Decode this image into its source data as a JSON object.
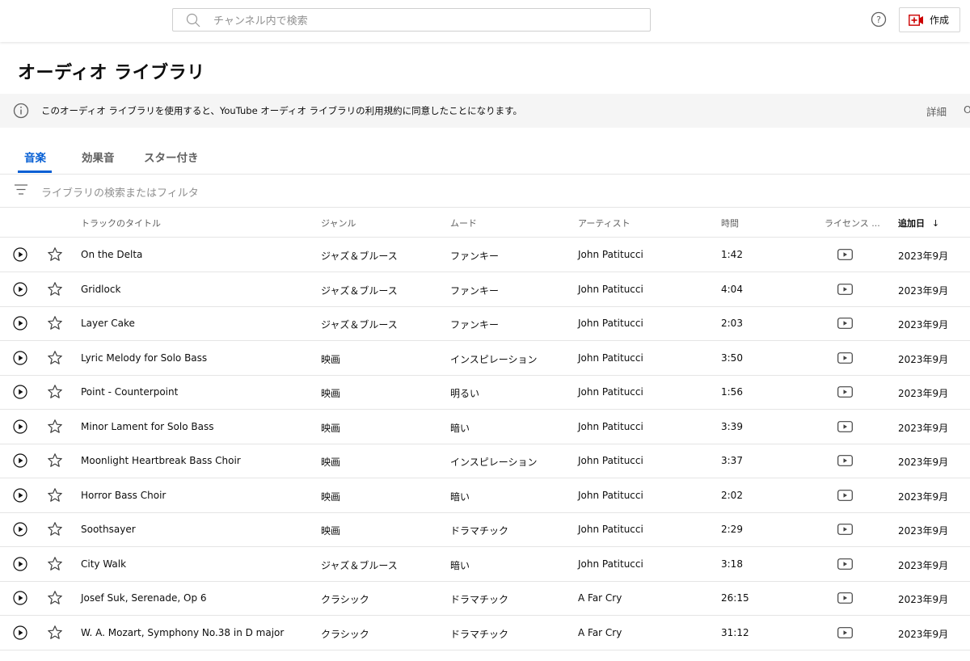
{
  "search": {
    "placeholder": "チャンネル内で検索"
  },
  "header": {
    "create_label": "作成"
  },
  "page": {
    "title": "オーディオ ライブラリ"
  },
  "notice": {
    "text": "このオーディオ ライブラリを使用すると、YouTube オーディオ ライブラリの利用規約に同意したことになります。",
    "more_label": "詳細",
    "ok_label": "O"
  },
  "tabs": [
    {
      "label": "音楽",
      "active": true
    },
    {
      "label": "効果音",
      "active": false
    },
    {
      "label": "スター付き",
      "active": false
    }
  ],
  "filter": {
    "placeholder": "ライブラリの検索またはフィルタ"
  },
  "columns": {
    "title": "トラックのタイトル",
    "genre": "ジャンル",
    "mood": "ムード",
    "artist": "アーティスト",
    "duration": "時間",
    "license": "ライセンス ...",
    "added": "追加日"
  },
  "sort_indicator": "↓",
  "tracks": [
    {
      "title": "On the Delta",
      "genre": "ジャズ＆ブルース",
      "mood": "ファンキー",
      "artist": "John Patitucci",
      "duration": "1:42",
      "added": "2023年9月"
    },
    {
      "title": "Gridlock",
      "genre": "ジャズ＆ブルース",
      "mood": "ファンキー",
      "artist": "John Patitucci",
      "duration": "4:04",
      "added": "2023年9月"
    },
    {
      "title": "Layer Cake",
      "genre": "ジャズ＆ブルース",
      "mood": "ファンキー",
      "artist": "John Patitucci",
      "duration": "2:03",
      "added": "2023年9月"
    },
    {
      "title": "Lyric Melody for Solo Bass",
      "genre": "映画",
      "mood": "インスピレーション",
      "artist": "John Patitucci",
      "duration": "3:50",
      "added": "2023年9月"
    },
    {
      "title": "Point - Counterpoint",
      "genre": "映画",
      "mood": "明るい",
      "artist": "John Patitucci",
      "duration": "1:56",
      "added": "2023年9月"
    },
    {
      "title": "Minor Lament for Solo Bass",
      "genre": "映画",
      "mood": "暗い",
      "artist": "John Patitucci",
      "duration": "3:39",
      "added": "2023年9月"
    },
    {
      "title": "Moonlight Heartbreak Bass Choir",
      "genre": "映画",
      "mood": "インスピレーション",
      "artist": "John Patitucci",
      "duration": "3:37",
      "added": "2023年9月"
    },
    {
      "title": "Horror Bass Choir",
      "genre": "映画",
      "mood": "暗い",
      "artist": "John Patitucci",
      "duration": "2:02",
      "added": "2023年9月"
    },
    {
      "title": "Soothsayer",
      "genre": "映画",
      "mood": "ドラマチック",
      "artist": "John Patitucci",
      "duration": "2:29",
      "added": "2023年9月"
    },
    {
      "title": "City Walk",
      "genre": "ジャズ＆ブルース",
      "mood": "暗い",
      "artist": "John Patitucci",
      "duration": "3:18",
      "added": "2023年9月"
    },
    {
      "title": "Josef Suk, Serenade, Op 6",
      "genre": "クラシック",
      "mood": "ドラマチック",
      "artist": "A Far Cry",
      "duration": "26:15",
      "added": "2023年9月"
    },
    {
      "title": "W. A. Mozart, Symphony No.38 in D major",
      "genre": "クラシック",
      "mood": "ドラマチック",
      "artist": "A Far Cry",
      "duration": "31:12",
      "added": "2023年9月"
    }
  ],
  "colors": {
    "accent": "#065fd4",
    "create_icon": "#cc0000",
    "notice_bg": "#f5f5f5"
  }
}
